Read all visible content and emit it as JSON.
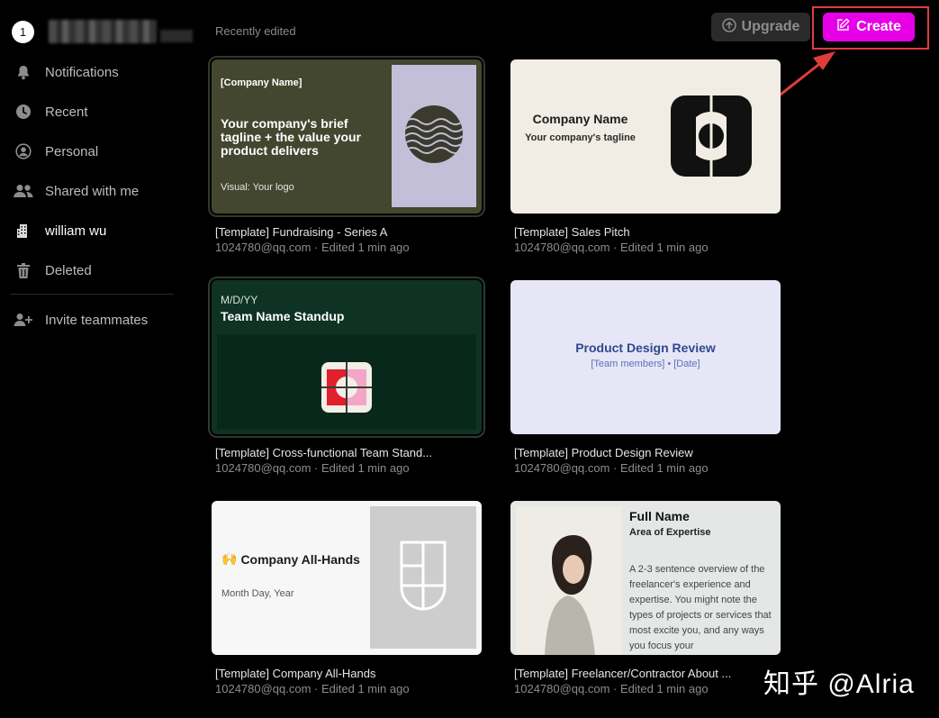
{
  "account": {
    "badge": "1"
  },
  "sidebar": {
    "items": [
      {
        "label": "Notifications",
        "icon": "bell-icon"
      },
      {
        "label": "Recent",
        "icon": "clock-icon"
      },
      {
        "label": "Personal",
        "icon": "user-circle-icon"
      },
      {
        "label": "Shared with me",
        "icon": "users-icon"
      },
      {
        "label": "william wu",
        "icon": "building-icon",
        "active": true
      },
      {
        "label": "Deleted",
        "icon": "trash-icon"
      }
    ],
    "invite": {
      "label": "Invite teammates",
      "icon": "user-plus-icon"
    }
  },
  "header": {
    "section_title": "Recently edited",
    "upgrade_label": "Upgrade",
    "create_label": "Create"
  },
  "cards": [
    {
      "title": "[Template] Fundraising - Series A",
      "meta": "1024780@qq.com · Edited 1 min ago",
      "preview": {
        "small": "[Company Name]",
        "big": "Your company's brief tagline + the value your product delivers",
        "foot": "Visual: Your logo",
        "bg": "#43472f"
      }
    },
    {
      "title": "[Template] Sales Pitch",
      "meta": "1024780@qq.com · Edited 1 min ago",
      "preview": {
        "big": "Company Name",
        "sub": "Your company's tagline",
        "bg": "#f1ede4"
      }
    },
    {
      "title": "[Template] Cross-functional Team Stand...",
      "meta": "1024780@qq.com · Edited 1 min ago",
      "preview": {
        "date": "M/D/YY",
        "big": "Team Name Standup",
        "bg": "#0e3325"
      }
    },
    {
      "title": "[Template] Product Design Review",
      "meta": "1024780@qq.com · Edited 1 min ago",
      "preview": {
        "big": "Product Design Review",
        "sub": "[Team members] • [Date]",
        "bg": "#e6e6f7"
      }
    },
    {
      "title": "[Template] Company All-Hands",
      "meta": "1024780@qq.com · Edited 1 min ago",
      "preview": {
        "emoji": "🙌",
        "big": "Company All-Hands",
        "sub": "Month Day, Year",
        "bg": "#f7f7f7"
      }
    },
    {
      "title": "[Template] Freelancer/Contractor About ...",
      "meta": "1024780@qq.com · Edited 1 min ago",
      "preview": {
        "big": "Full Name",
        "sub": "Area of Expertise",
        "body": "A 2-3 sentence overview of the freelancer's experience and expertise. You might note the types of projects or services that most excite you, and any ways you focus your",
        "bg": "#e4e7e6"
      }
    }
  ],
  "colors": {
    "accent": "#e600e6",
    "annotation": "#e23b3b"
  },
  "watermark": "知乎 @Alria"
}
